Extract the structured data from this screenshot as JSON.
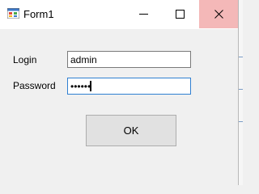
{
  "window": {
    "title": "Form1",
    "close_hover_color": "#f4b8b8",
    "icons": {
      "app": "winforms-app-icon",
      "minimize": "minimize-icon",
      "maximize": "maximize-icon",
      "close": "close-icon"
    }
  },
  "form": {
    "login_label": "Login",
    "login_value": "admin",
    "password_label": "Password",
    "password_value": "••••••",
    "ok_label": "OK"
  },
  "colors": {
    "focus_border": "#2f7fd1",
    "background": "#f0f0f0"
  }
}
